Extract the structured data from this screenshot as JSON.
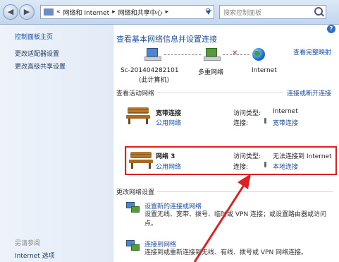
{
  "address_bar": {
    "path": [
      "网络和 Internet",
      "网络和共享中心"
    ],
    "separator": "▸",
    "prefix": "«"
  },
  "search": {
    "placeholder": "搜索控制面板"
  },
  "sidebar": {
    "home_link": "控制面板主页",
    "links": [
      "更改适配器设置",
      "更改高级共享设置"
    ],
    "see_also_heading": "另请参阅",
    "see_also_links": [
      "Internet 选项"
    ]
  },
  "main": {
    "title": "查看基本网络信息并设置连接",
    "full_map_link": "查看完整映射",
    "map": {
      "computer_name": "Sc-201404282101",
      "computer_caption": "(此计算机)",
      "middle_label": "多重网络",
      "internet_label": "Internet"
    },
    "active_networks": {
      "heading": "查看活动网络",
      "action_link": "连接或断开连接",
      "networks": [
        {
          "name": "宽带连接",
          "type": "公用网络",
          "access_label": "访问类型:",
          "access_value": "Internet",
          "conn_label": "连接:",
          "conn_value": "宽带连接"
        },
        {
          "name": "网络  3",
          "type": "公用网络",
          "access_label": "访问类型:",
          "access_value": "无法连接到 Internet",
          "conn_label": "连接:",
          "conn_value": "本地连接"
        }
      ]
    },
    "change_settings": {
      "heading": "更改网络设置",
      "tasks": [
        {
          "title": "设置新的连接或网络",
          "description": "设置无线、宽带、拨号、临时或 VPN 连接；或设置路由器或访问点。"
        },
        {
          "title": "连接到网络",
          "description": "连接到或重新连接到无线、有线、拨号或 VPN 网络连接。"
        }
      ]
    }
  },
  "colors": {
    "link": "#1b4fa3",
    "highlight_box": "#e02020",
    "sidebar_bg": "#e3ebf7"
  }
}
